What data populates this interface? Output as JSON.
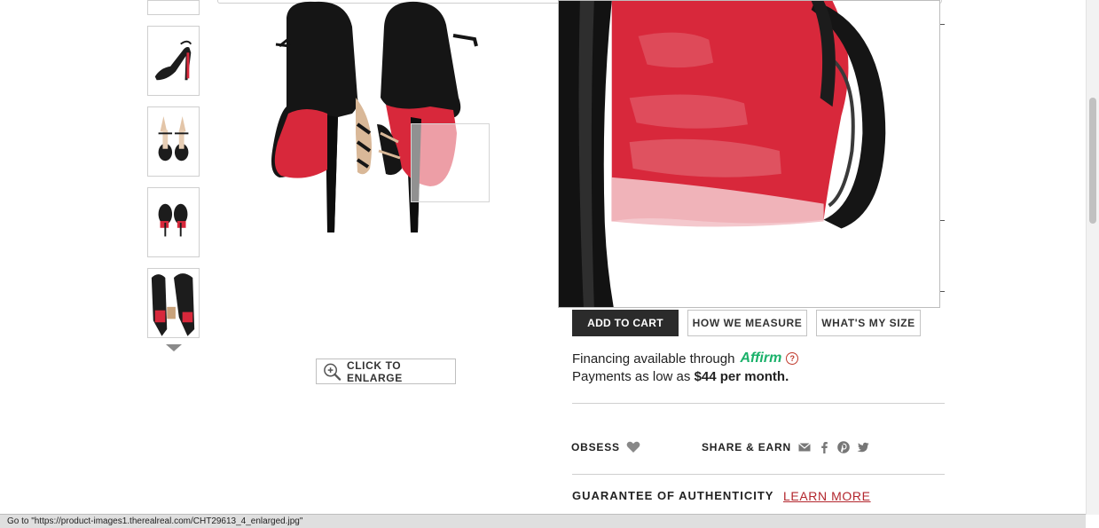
{
  "thumbnails": [
    {
      "name": "thumb-partial"
    },
    {
      "name": "thumb-side-view"
    },
    {
      "name": "thumb-front-view"
    },
    {
      "name": "thumb-back-view"
    },
    {
      "name": "thumb-closeup-view"
    }
  ],
  "gallery": {
    "enlarge_label": "CLICK TO ENLARGE"
  },
  "actions": {
    "add_to_cart": "ADD TO CART",
    "how_we_measure": "HOW WE MEASURE",
    "whats_my_size": "WHAT'S MY SIZE"
  },
  "financing": {
    "line1_prefix": "Financing available through",
    "provider": "Affirm",
    "help_icon": "?",
    "line2_prefix": "Payments as low as",
    "amount": "$44 per month."
  },
  "social": {
    "obsess_label": "OBSESS",
    "share_label": "SHARE & EARN",
    "icons": [
      "mail-icon",
      "facebook-icon",
      "pinterest-icon",
      "twitter-icon"
    ]
  },
  "authenticity": {
    "label": "GUARANTEE OF AUTHENTICITY",
    "link": "LEARN MORE"
  },
  "status_bar": {
    "text": "Go to \"https://product-images1.therealreal.com/CHT29613_4_enlarged.jpg\""
  },
  "colors": {
    "sole_red": "#d8283b",
    "affirm_green": "#1ab16a",
    "link_red": "#b3262d",
    "cart_bg": "#2b2b2b"
  }
}
